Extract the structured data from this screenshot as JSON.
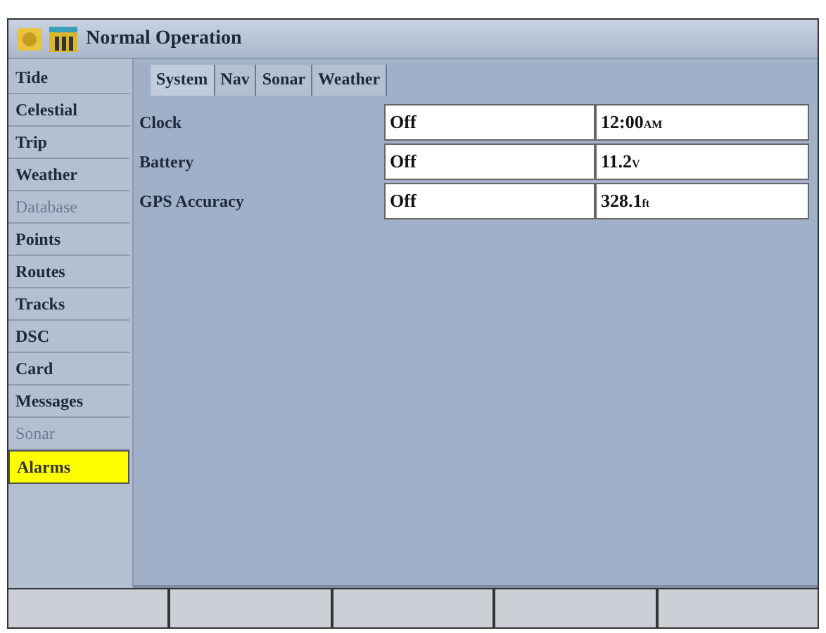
{
  "window": {
    "title": "Normal Operation"
  },
  "sidebar": {
    "items": [
      {
        "label": "Tide",
        "selected": false,
        "disabled": false
      },
      {
        "label": "Celestial",
        "selected": false,
        "disabled": false
      },
      {
        "label": "Trip",
        "selected": false,
        "disabled": false
      },
      {
        "label": "Weather",
        "selected": false,
        "disabled": false
      },
      {
        "label": "Database",
        "selected": false,
        "disabled": true
      },
      {
        "label": "Points",
        "selected": false,
        "disabled": false
      },
      {
        "label": "Routes",
        "selected": false,
        "disabled": false
      },
      {
        "label": "Tracks",
        "selected": false,
        "disabled": false
      },
      {
        "label": "DSC",
        "selected": false,
        "disabled": false
      },
      {
        "label": "Card",
        "selected": false,
        "disabled": false
      },
      {
        "label": "Messages",
        "selected": false,
        "disabled": false
      },
      {
        "label": "Sonar",
        "selected": false,
        "disabled": true
      },
      {
        "label": "Alarms",
        "selected": true,
        "disabled": false
      }
    ]
  },
  "tabs": [
    {
      "label": "System",
      "selected": true
    },
    {
      "label": "Nav",
      "selected": false
    },
    {
      "label": "Sonar",
      "selected": false
    },
    {
      "label": "Weather",
      "selected": false
    }
  ],
  "alarms": [
    {
      "label": "Clock",
      "state": "Off",
      "value": "12:00",
      "unit": "AM"
    },
    {
      "label": "Battery",
      "state": "Off",
      "value": "11.2",
      "unit": "V"
    },
    {
      "label": "GPS Accuracy",
      "state": "Off",
      "value": "328.1",
      "unit": "ft"
    }
  ]
}
